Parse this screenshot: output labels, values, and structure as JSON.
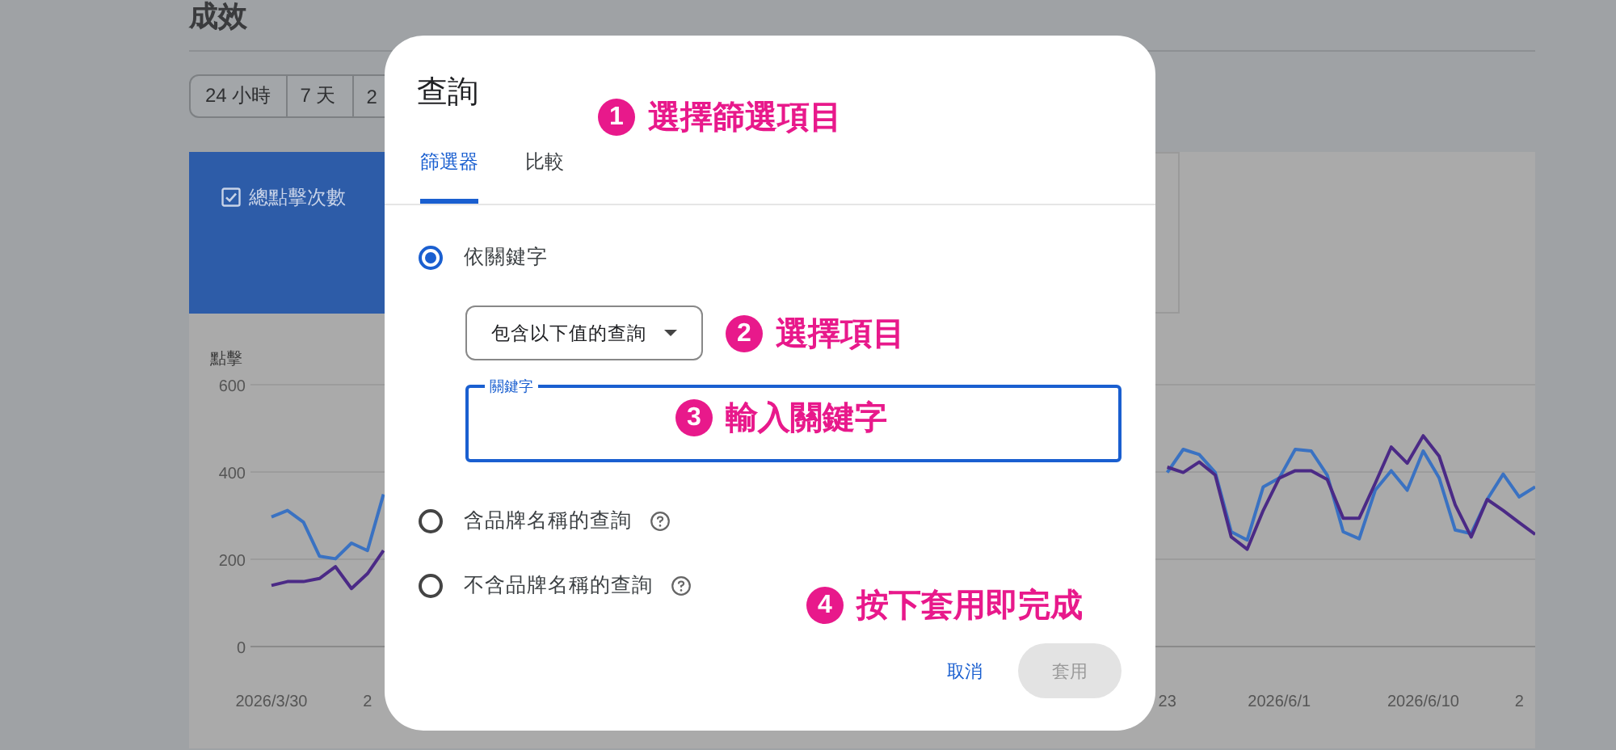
{
  "page": {
    "title": "成效",
    "date_ranges": [
      {
        "label": "24 小時"
      },
      {
        "label": "7 天"
      },
      {
        "label": "2"
      }
    ],
    "metric_cards": [
      {
        "label": "總點擊次數",
        "checked": true
      }
    ],
    "chart": {
      "chart_data": {
        "type": "line",
        "ylabel": "點擊",
        "ylim": [
          0,
          600
        ],
        "yticks": [
          0,
          200,
          400,
          600
        ],
        "categories": [
          "2026/3/30",
          null,
          null,
          null,
          null,
          null,
          "2",
          null,
          null,
          null,
          null,
          null,
          null,
          null,
          null,
          null,
          null,
          null,
          null,
          null,
          null,
          null,
          null,
          null,
          null,
          null,
          null,
          null,
          null,
          null,
          null,
          null,
          null,
          null,
          null,
          null,
          null,
          null,
          null,
          null,
          null,
          null,
          null,
          null,
          null,
          null,
          null,
          null,
          null,
          null,
          null,
          null,
          null,
          null,
          null,
          null,
          "23",
          null,
          null,
          null,
          null,
          null,
          null,
          "2026/6/1",
          null,
          null,
          null,
          null,
          null,
          null,
          null,
          null,
          "2026/6/10",
          null,
          null,
          null,
          null,
          null,
          "2",
          null
        ],
        "series": [
          {
            "color": "#3a72c2",
            "values": [
              297,
              312,
              285,
              207,
              201,
              237,
              220,
              349,
              null,
              null,
              null,
              null,
              null,
              null,
              null,
              null,
              null,
              null,
              null,
              null,
              null,
              null,
              null,
              null,
              null,
              null,
              null,
              null,
              null,
              null,
              null,
              null,
              null,
              null,
              null,
              null,
              null,
              null,
              null,
              null,
              null,
              null,
              null,
              null,
              null,
              null,
              null,
              null,
              null,
              null,
              null,
              null,
              null,
              null,
              null,
              null,
              399,
              452,
              440,
              399,
              263,
              244,
              366,
              386,
              452,
              448,
              393,
              263,
              247,
              358,
              403,
              358,
              448,
              386,
              267,
              259,
              337,
              395,
              343,
              366
            ]
          },
          {
            "color": "#4b2a86",
            "values": [
              140,
              149,
              149,
              156,
              183,
              133,
              167,
              220,
              null,
              null,
              null,
              null,
              null,
              null,
              null,
              null,
              null,
              null,
              null,
              null,
              null,
              null,
              null,
              null,
              null,
              null,
              null,
              null,
              null,
              null,
              null,
              null,
              null,
              null,
              null,
              null,
              null,
              null,
              null,
              null,
              null,
              null,
              null,
              null,
              null,
              null,
              null,
              null,
              null,
              null,
              null,
              null,
              null,
              null,
              null,
              null,
              411,
              399,
              423,
              393,
              251,
              223,
              312,
              386,
              403,
              403,
              383,
              294,
              294,
              374,
              457,
              420,
              483,
              436,
              325,
              251,
              337,
              312,
              284,
              257
            ]
          }
        ]
      }
    }
  },
  "dialog": {
    "title": "查詢",
    "tabs": [
      {
        "label": "篩選器",
        "selected": true
      },
      {
        "label": "比較",
        "selected": false
      }
    ],
    "options": [
      {
        "label": "依關鍵字",
        "selected": true,
        "help": false
      },
      {
        "label": "含品牌名稱的查詢",
        "selected": false,
        "help": true
      },
      {
        "label": "不含品牌名稱的查詢",
        "selected": false,
        "help": true
      }
    ],
    "match_dropdown": {
      "value": "包含以下值的查詢"
    },
    "keyword_field": {
      "label": "關鍵字"
    },
    "buttons": [
      {
        "label": "取消",
        "disabled": false
      },
      {
        "label": "套用",
        "disabled": true
      }
    ]
  },
  "annotations": [
    {
      "number": "1",
      "text": "選擇篩選項目"
    },
    {
      "number": "2",
      "text": "選擇項目"
    },
    {
      "number": "3",
      "text": "輸入關鍵字"
    },
    {
      "number": "4",
      "text": "按下套用即完成"
    }
  ]
}
